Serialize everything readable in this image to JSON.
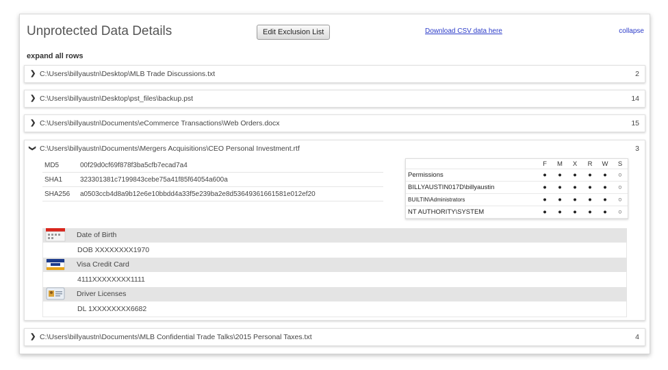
{
  "header": {
    "title": "Unprotected Data Details",
    "edit_button": "Edit Exclusion List",
    "download_link": "Download CSV data here",
    "collapse_link": "collapse"
  },
  "expand_all": "expand all rows",
  "files": [
    {
      "path": "C:\\Users\\billyaustn\\Desktop\\MLB Trade Discussions.txt",
      "count": "2"
    },
    {
      "path": "C:\\Users\\billyaustn\\Desktop\\pst_files\\backup.pst",
      "count": "14"
    },
    {
      "path": "C:\\Users\\billyaustn\\Documents\\eCommerce Transactions\\Web Orders.docx",
      "count": "15"
    }
  ],
  "expanded_file": {
    "path": "C:\\Users\\billyaustn\\Documents\\Mergers Acquisitions\\CEO Personal Investment.rtf",
    "count": "3",
    "hashes": [
      {
        "key": "MD5",
        "value": "00f29d0cf69f878f3ba5cfb7ecad7a4"
      },
      {
        "key": "SHA1",
        "value": "323301381c7199843cebe75a41f85f64054a600a"
      },
      {
        "key": "SHA256",
        "value": "a0503ccb4d8a9b12e6e10bbdd4a33f5e239ba2e8d53649361661581e012ef20"
      }
    ],
    "permissions": {
      "columns": [
        "F",
        "M",
        "X",
        "R",
        "W",
        "S"
      ],
      "label": "Permissions",
      "rows": [
        {
          "name": "Permissions",
          "marks": [
            "●",
            "●",
            "●",
            "●",
            "●",
            "○"
          ]
        },
        {
          "name": "BILLYAUSTIN017D\\billyaustin",
          "marks": [
            "●",
            "●",
            "●",
            "●",
            "●",
            "○"
          ]
        },
        {
          "name": "BUILTIN\\Administrators",
          "marks": [
            "●",
            "●",
            "●",
            "●",
            "●",
            "○"
          ]
        },
        {
          "name": "NT AUTHORITY\\SYSTEM",
          "marks": [
            "●",
            "●",
            "●",
            "●",
            "●",
            "○"
          ]
        }
      ]
    },
    "pii": [
      {
        "label": "Date of Birth",
        "value": "DOB XXXXXXXX1970",
        "icon": "calendar-icon"
      },
      {
        "label": "Visa Credit Card",
        "value": "4111XXXXXXXX1111",
        "icon": "visa-card-icon"
      },
      {
        "label": "Driver Licenses",
        "value": "DL 1XXXXXXXX6682",
        "icon": "id-card-icon"
      }
    ]
  },
  "last_file": {
    "path": "C:\\Users\\billyaustn\\Documents\\MLB Confidential Trade Talks\\2015 Personal Taxes.txt",
    "count": "4"
  },
  "chevrons": {
    "collapsed": "❯",
    "expanded": "❯"
  },
  "colors": {
    "link": "#2a3ac8",
    "row_label_bg": "#e4e4e4",
    "cal_red": "#d9251c",
    "visa_blue": "#1a3a8c"
  }
}
